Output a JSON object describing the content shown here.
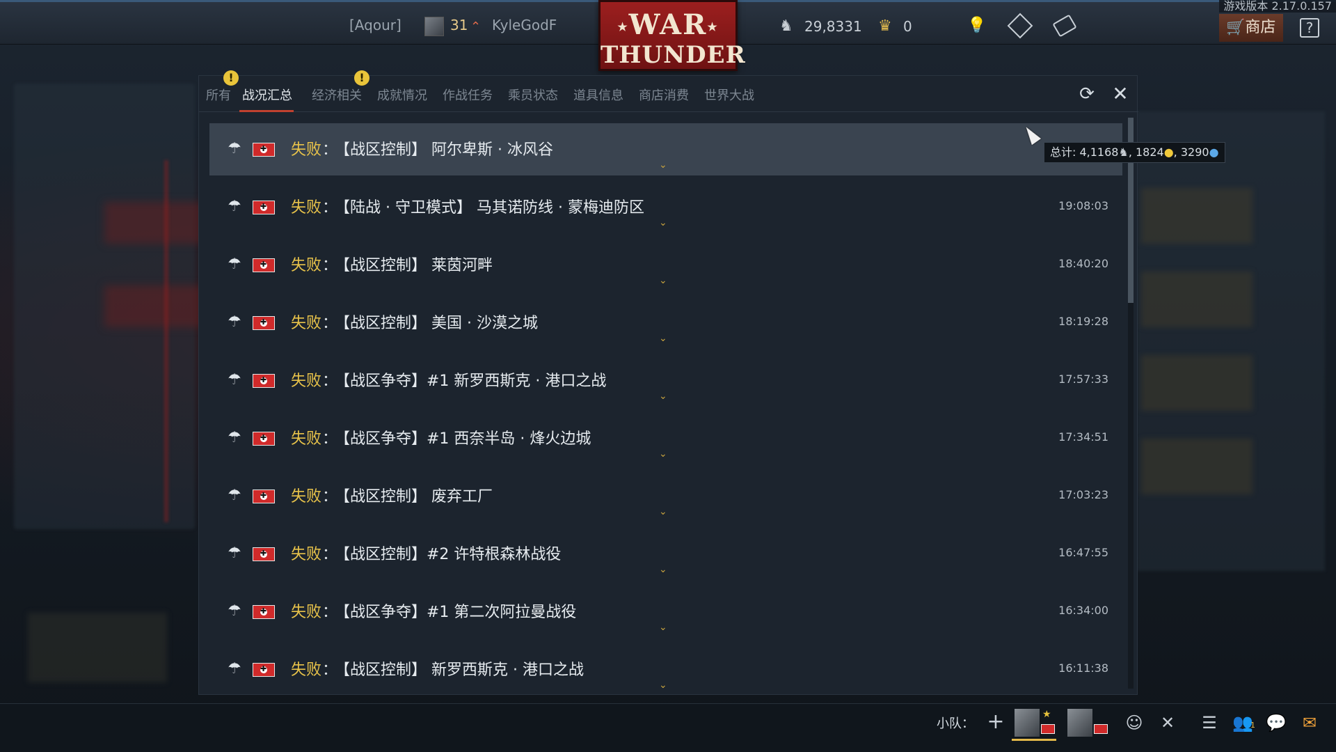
{
  "top_bar": {
    "version": "游戏版本 2.17.0.157",
    "clan": "[Aqour]",
    "level": "31",
    "nickname": "KyleGodF",
    "logo_line1": "WAR",
    "logo_line2": "THUNDER",
    "silver": "29,8331",
    "gold": "0",
    "shop_label": "商店",
    "help_label": "?"
  },
  "tabs": [
    {
      "label": "所有",
      "warning": true
    },
    {
      "label": "战况汇总",
      "active": true
    },
    {
      "label": "经济相关",
      "warning": true
    },
    {
      "label": "成就情况"
    },
    {
      "label": "作战任务"
    },
    {
      "label": "乘员状态"
    },
    {
      "label": "道具信息"
    },
    {
      "label": "商店消费"
    },
    {
      "label": "世界大战"
    }
  ],
  "warning_glyph": "!",
  "entries": [
    {
      "result": "失败",
      "title": "【战区控制】 阿尔卑斯 · 冰风谷",
      "time": ""
    },
    {
      "result": "失败",
      "title": "【陆战 · 守卫模式】 马其诺防线 · 蒙梅迪防区",
      "time": "19:08:03"
    },
    {
      "result": "失败",
      "title": "【战区控制】 莱茵河畔",
      "time": "18:40:20"
    },
    {
      "result": "失败",
      "title": "【战区控制】 美国 · 沙漠之城",
      "time": "18:19:28"
    },
    {
      "result": "失败",
      "title": "【战区争夺】#1 新罗西斯克 · 港口之战",
      "time": "17:57:33"
    },
    {
      "result": "失败",
      "title": "【战区争夺】#1 西奈半岛 · 烽火边城",
      "time": "17:34:51"
    },
    {
      "result": "失败",
      "title": "【战区控制】 废弃工厂",
      "time": "17:03:23"
    },
    {
      "result": "失败",
      "title": "【战区控制】#2 许特根森林战役",
      "time": "16:47:55"
    },
    {
      "result": "失败",
      "title": "【战区争夺】#1 第二次阿拉曼战役",
      "time": "16:34:00"
    },
    {
      "result": "失败",
      "title": "【战区控制】 新罗西斯克 · 港口之战",
      "time": "16:11:38"
    }
  ],
  "tooltip": {
    "prefix": "总计: ",
    "silver": "4,1168",
    "sep1": ", ",
    "research": "1824",
    "sep2": ", ",
    "free_rp": "3290"
  },
  "bottom_bar": {
    "squad_label": "小队："
  },
  "colors": {
    "accent_red": "#c0412f",
    "result_gold": "#e8c34a",
    "highlight_row": "#3a4450"
  }
}
